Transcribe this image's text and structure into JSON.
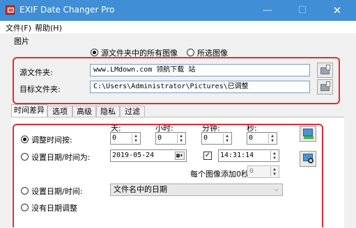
{
  "window": {
    "title": "EXIF Date Changer Pro",
    "minimize_glyph": "—",
    "maximize_glyph": "☐",
    "close_glyph": "✕",
    "titlebar_color": "#3f8ed6"
  },
  "menu": {
    "file": "文件(F)",
    "help": "帮助(H)"
  },
  "images_group": {
    "title": "图片",
    "option_all": "源文件夹中的所有图像",
    "option_selected": "所选图像",
    "selected_option": "all",
    "source_label": "源文件夹:",
    "source_value": "www.LMdown.com  领航下载 站",
    "target_label": "目标文件夹:",
    "target_value": "C:\\Users\\Administrator\\Pictures\\已调整"
  },
  "tabs": [
    "时间差异",
    "选项",
    "高级",
    "隐私",
    "过滤"
  ],
  "active_tab": "时间差异",
  "time_diff": {
    "adjust_label": "调整时间按:",
    "headers": {
      "days": "天:",
      "hours": "小时:",
      "minutes": "分钟:",
      "seconds": "秒:"
    },
    "days_value": "0",
    "hours_value": "0",
    "minutes_value": "0",
    "seconds_value": "0",
    "set_date_time_label": "设置日期/时间为:",
    "date_value": "2019-05-24",
    "time_value": "14:31:14",
    "time_checked": true,
    "increment_label": "每个图像添加0秒",
    "increment_value": "0",
    "set_from_label": "设置日期/时间:",
    "set_from_value": "文件名中的日期",
    "no_adjust_label": "没有日期调整",
    "selected_option": "adjust"
  },
  "accent_red": "#e8282e"
}
